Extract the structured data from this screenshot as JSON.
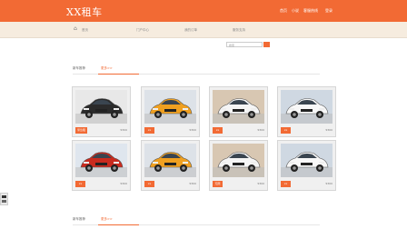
{
  "header": {
    "logo": "XX租车",
    "nav": [
      "首页",
      "小说",
      "客服热线",
      "登录"
    ]
  },
  "subnav": {
    "items": [
      "首页",
      "门户中心",
      "我的订单",
      "服务支持"
    ]
  },
  "search": {
    "placeholder": "搜索"
  },
  "sections": [
    {
      "title": "新车推荐",
      "more": "更多>>"
    },
    {
      "title": "新车推荐",
      "more": "更多>>"
    }
  ],
  "cars": [
    {
      "name": "black-audi",
      "tag": "紧急租",
      "price": "¥300",
      "body": "#2b2b2b",
      "bg": "#e8e8e8"
    },
    {
      "name": "yellow-audi",
      "tag": "xx",
      "price": "¥300",
      "body": "#f0a020",
      "bg": "#dde2e8"
    },
    {
      "name": "white-audi",
      "tag": "xx",
      "price": "¥300",
      "body": "#f5f5f5",
      "bg": "#d8c7b2"
    },
    {
      "name": "white-sedan",
      "tag": "xx",
      "price": "¥300",
      "body": "#f8f8f8",
      "bg": "#cfd8e2"
    },
    {
      "name": "red-audi",
      "tag": "xx",
      "price": "¥300",
      "body": "#c92b1f",
      "bg": "#dfe6ee"
    },
    {
      "name": "yellow-audi",
      "tag": "xx",
      "price": "¥300",
      "body": "#f0a020",
      "bg": "#dde2e8"
    },
    {
      "name": "white-audi",
      "tag": "无限",
      "price": "¥300",
      "body": "#f5f5f5",
      "bg": "#d8c7b2"
    },
    {
      "name": "white-sedan",
      "tag": "xx",
      "price": "¥300",
      "body": "#f8f8f8",
      "bg": "#cfd8e2"
    }
  ],
  "colors": {
    "accent": "#f26a34",
    "subnav_bg": "#f6ecdf"
  }
}
